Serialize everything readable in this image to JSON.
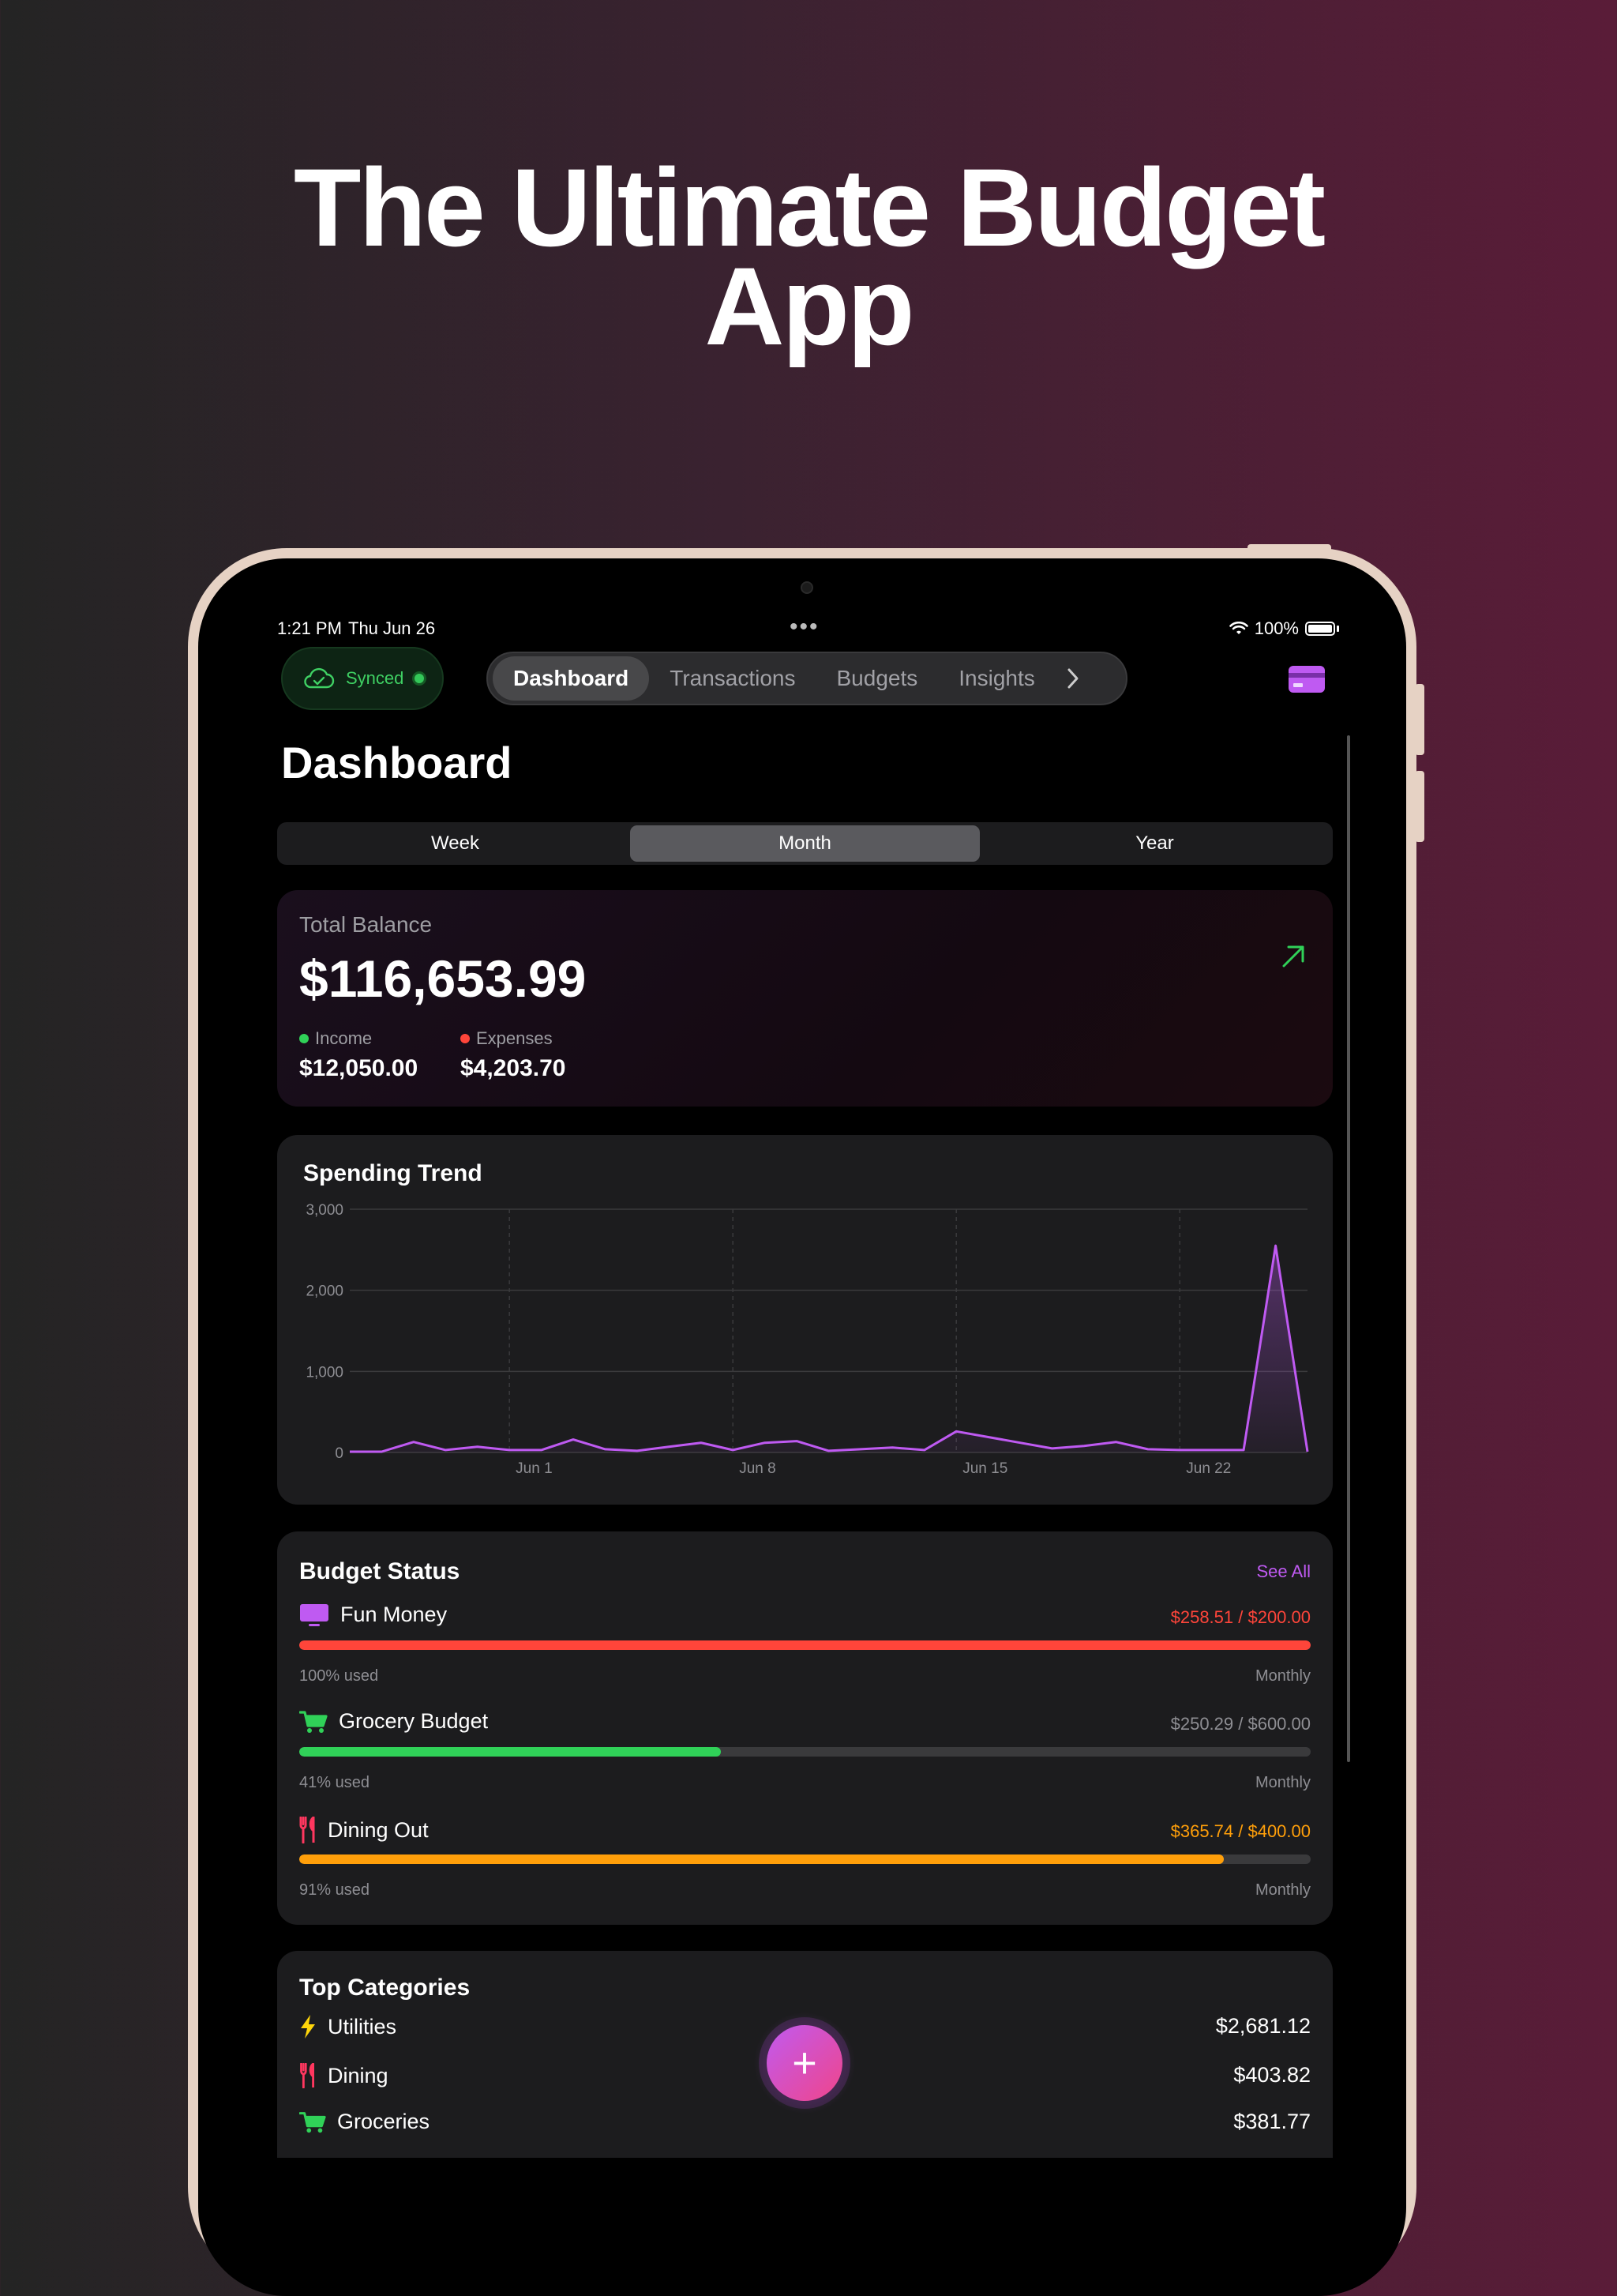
{
  "marketing": {
    "headline_line1": "The Ultimate Budget",
    "headline_line2": "App"
  },
  "status_bar": {
    "time": "1:21 PM",
    "date": "Thu Jun 26",
    "battery": "100%"
  },
  "sync": {
    "label": "Synced"
  },
  "nav": {
    "tabs": [
      {
        "label": "Dashboard",
        "active": true
      },
      {
        "label": "Transactions",
        "active": false
      },
      {
        "label": "Budgets",
        "active": false
      },
      {
        "label": "Insights",
        "active": false
      }
    ],
    "more_icon": "chevron-right-icon",
    "card_icon": "credit-card-icon"
  },
  "page": {
    "title": "Dashboard"
  },
  "period": {
    "options": [
      "Week",
      "Month",
      "Year"
    ],
    "selected": "Month"
  },
  "balance": {
    "label": "Total Balance",
    "value": "$116,653.99",
    "trend_icon": "arrow-up-right-icon",
    "income_label": "Income",
    "income_value": "$12,050.00",
    "expenses_label": "Expenses",
    "expenses_value": "$4,203.70"
  },
  "chart_data": {
    "type": "area",
    "title": "Spending Trend",
    "x": [
      "May 27",
      "May 28",
      "May 29",
      "May 30",
      "May 31",
      "Jun 1",
      "Jun 2",
      "Jun 3",
      "Jun 4",
      "Jun 5",
      "Jun 6",
      "Jun 7",
      "Jun 8",
      "Jun 9",
      "Jun 10",
      "Jun 11",
      "Jun 12",
      "Jun 13",
      "Jun 14",
      "Jun 15",
      "Jun 16",
      "Jun 17",
      "Jun 18",
      "Jun 19",
      "Jun 20",
      "Jun 21",
      "Jun 22",
      "Jun 23",
      "Jun 24",
      "Jun 25",
      "Jun 26"
    ],
    "values": [
      10,
      10,
      130,
      30,
      70,
      30,
      30,
      160,
      40,
      20,
      70,
      120,
      30,
      120,
      140,
      20,
      40,
      60,
      30,
      260,
      190,
      120,
      50,
      80,
      130,
      40,
      30,
      30,
      30,
      2550,
      10
    ],
    "x_tick_labels": [
      "Jun 1",
      "Jun 8",
      "Jun 15",
      "Jun 22"
    ],
    "y_ticks": [
      "0",
      "1,000",
      "2,000",
      "3,000"
    ],
    "ylim": [
      0,
      3000
    ],
    "grid": true,
    "color": "#bf5af2"
  },
  "budget_status": {
    "title": "Budget Status",
    "see_all": "See All",
    "items": [
      {
        "name": "Fun Money",
        "icon": "tv-icon",
        "amount": "$258.51 / $200.00",
        "used": "100% used",
        "period": "Monthly",
        "fraction": 1.0,
        "bar_color": "#ff453a",
        "amount_color": "#ff453a"
      },
      {
        "name": "Grocery Budget",
        "icon": "cart-icon",
        "amount": "$250.29 / $600.00",
        "used": "41% used",
        "period": "Monthly",
        "fraction": 0.417,
        "bar_color": "#30d158",
        "amount_color": "#8e8e93"
      },
      {
        "name": "Dining Out",
        "icon": "fork-knife-icon",
        "amount": "$365.74 / $400.00",
        "used": "91% used",
        "period": "Monthly",
        "fraction": 0.914,
        "bar_color": "#ff9f0a",
        "amount_color": "#ff9f0a"
      }
    ]
  },
  "top_categories": {
    "title": "Top Categories",
    "items": [
      {
        "name": "Utilities",
        "icon": "bolt-icon",
        "amount": "$2,681.12"
      },
      {
        "name": "Dining",
        "icon": "fork-knife-icon",
        "amount": "$403.82"
      },
      {
        "name": "Groceries",
        "icon": "cart-icon",
        "amount": "$381.77"
      }
    ]
  },
  "fab": {
    "label": "+"
  },
  "colors": {
    "accent": "#bf5af2",
    "income": "#30d158",
    "expense": "#ff453a",
    "warning": "#ff9f0a"
  }
}
